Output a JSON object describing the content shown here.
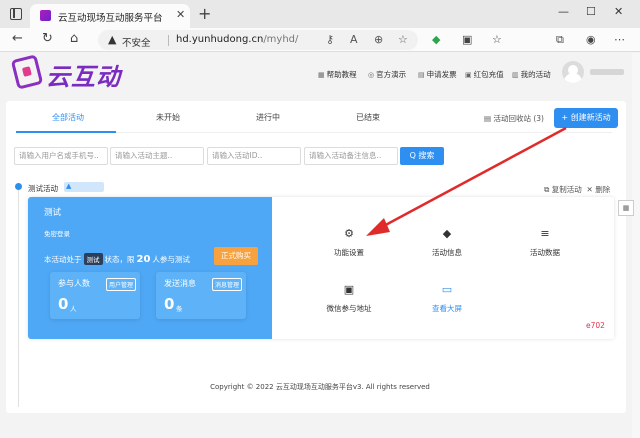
{
  "browser": {
    "tab_title": "云互动现场互动服务平台",
    "tab_close": "✕",
    "new_tab": "+",
    "win_controls": [
      "—",
      "☐",
      "✕"
    ],
    "nav_icons": [
      "←",
      "↻",
      "⌂"
    ],
    "not_secure": "不安全",
    "url_host": "hd.yunhudong.cn",
    "url_path": "/myhd/",
    "omnibox_icons": [
      "⚷",
      "A",
      "⊕",
      "☆"
    ],
    "toolbar_icons": [
      "◆",
      "▣",
      "☆",
      "⧉",
      "◉",
      "⋯"
    ]
  },
  "header": {
    "logo_text": "云互动",
    "nav": [
      {
        "icon": "▦",
        "label": "帮助教程"
      },
      {
        "icon": "◎",
        "label": "官方演示"
      },
      {
        "icon": "▤",
        "label": "申请发票"
      },
      {
        "icon": "▣",
        "label": "红包充值"
      },
      {
        "icon": "▥",
        "label": "我的活动"
      }
    ]
  },
  "tabs": {
    "items": [
      "全部活动",
      "未开始",
      "进行中",
      "已结束"
    ],
    "active": "全部活动",
    "recycle": "▤ 活动回收站 (3)",
    "create_button": "+ 创建新活动"
  },
  "filters": {
    "placeholders": [
      "请输入用户名或手机号..",
      "请输入活动主题..",
      "请输入活动ID..",
      "请输入活动备注信息.."
    ],
    "search_button": "Q 搜索"
  },
  "activity": {
    "name": "测试活动",
    "tag_icon": "▲",
    "copy_link": "⧉ 复制活动",
    "delete_link": "✕ 删除",
    "card": {
      "title": "测试",
      "subtitle": "免密登录",
      "status_prefix": "本活动处于",
      "status_badge": "测试",
      "status_mid": "状态，限",
      "status_limit": "20",
      "status_suffix": "人参与测试",
      "buy_button": "正式购买",
      "stats": [
        {
          "label": "参与人数",
          "button": "用户管理",
          "value": "0",
          "unit": "人"
        },
        {
          "label": "发送消息",
          "button": "消息管理",
          "value": "0",
          "unit": "条"
        }
      ]
    },
    "features": [
      {
        "icon": "⚙",
        "label": "功能设置"
      },
      {
        "icon": "◆",
        "label": "活动信息"
      },
      {
        "icon": "≡",
        "label": "活动数据"
      },
      {
        "icon": "▣",
        "label": "微信参与地址"
      },
      {
        "icon": "▭",
        "label": "查看大屏"
      }
    ],
    "ie_icon": "e",
    "ie_count": "702"
  },
  "side_float_icon": "▦",
  "footer": "Copyright © 2022 云互动现场互动服务平台v3. All rights reserved"
}
